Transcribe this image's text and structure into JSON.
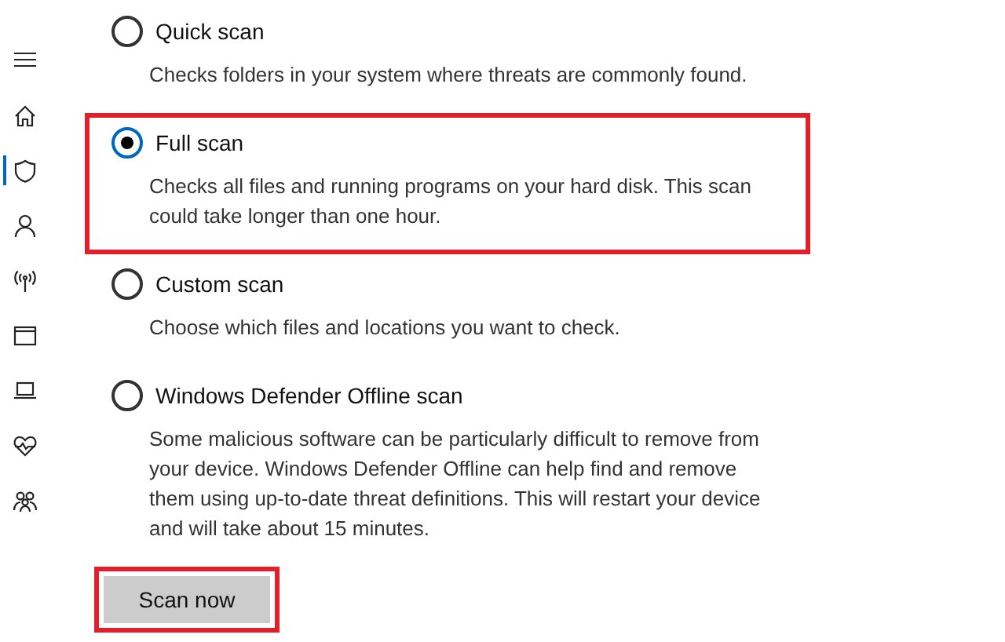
{
  "sidebar": {
    "items": [
      {
        "selected": false
      },
      {
        "selected": false
      },
      {
        "selected": true
      },
      {
        "selected": false
      },
      {
        "selected": false
      },
      {
        "selected": false
      },
      {
        "selected": false
      },
      {
        "selected": false
      },
      {
        "selected": false
      }
    ]
  },
  "scan_options": [
    {
      "label": "Quick scan",
      "description": "Checks folders in your system where threats are commonly found.",
      "selected": false,
      "highlighted": false
    },
    {
      "label": "Full scan",
      "description": "Checks all files and running programs on your hard disk. This scan could take longer than one hour.",
      "selected": true,
      "highlighted": true
    },
    {
      "label": "Custom scan",
      "description": "Choose which files and locations you want to check.",
      "selected": false,
      "highlighted": false
    },
    {
      "label": "Windows Defender Offline scan",
      "description": "Some malicious software can be particularly difficult to remove from your device. Windows Defender Offline can help find and remove them using up-to-date threat definitions. This will restart your device and will take about 15 minutes.",
      "selected": false,
      "highlighted": false
    }
  ],
  "scan_button": {
    "label": "Scan now",
    "highlighted": true
  }
}
